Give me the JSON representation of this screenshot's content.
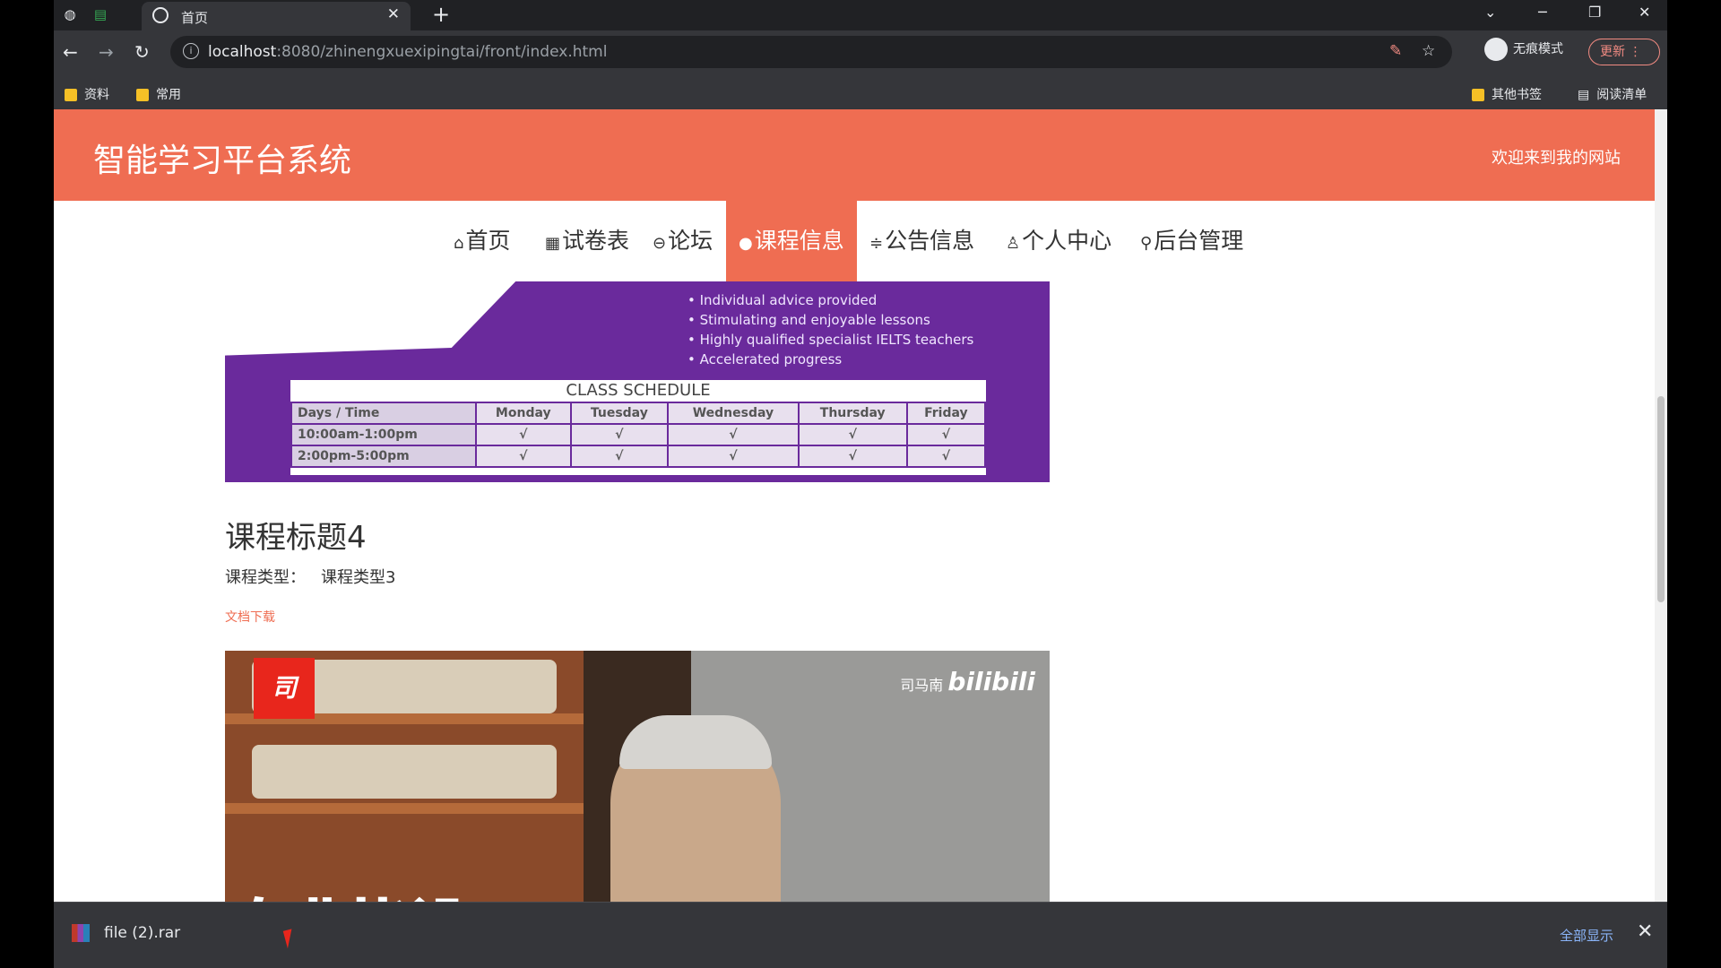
{
  "browser": {
    "tab_title": "首页",
    "url_host": "localhost",
    "url_path": ":8080/zhinengxuexipingtai/front/index.html",
    "incognito_label": "无痕模式",
    "update_label": "更新",
    "bookmarks": [
      "资料",
      "常用"
    ],
    "other_bookmarks": "其他书签",
    "reading_list": "阅读清单"
  },
  "site": {
    "title": "智能学习平台系统",
    "welcome": "欢迎来到我的网站"
  },
  "nav": {
    "items": [
      {
        "icon": "⌂",
        "label": "首页"
      },
      {
        "icon": "▦",
        "label": "试卷表"
      },
      {
        "icon": "⊖",
        "label": "论坛"
      },
      {
        "icon": "●",
        "label": "课程信息"
      },
      {
        "icon": "≑",
        "label": "公告信息"
      },
      {
        "icon": "♙",
        "label": "个人中心"
      },
      {
        "icon": "⚲",
        "label": "后台管理"
      }
    ],
    "active_index": 3
  },
  "banner": {
    "bullets": [
      "• Individual advice provided",
      "• Stimulating and enjoyable lessons",
      "• Highly qualified specialist IELTS teachers",
      "• Accelerated progress"
    ],
    "schedule_title": "CLASS SCHEDULE",
    "columns": [
      "Days / Time",
      "Monday",
      "Tuesday",
      "Wednesday",
      "Thursday",
      "Friday"
    ],
    "rows": [
      [
        "10:00am-1:00pm",
        "√",
        "√",
        "√",
        "√",
        "√"
      ],
      [
        "2:00pm-5:00pm",
        "√",
        "√",
        "√",
        "√",
        "√"
      ]
    ]
  },
  "course": {
    "title": "课程标题4",
    "type_label": "课程类型：",
    "type_value": "课程类型3",
    "download_label": "文档下载"
  },
  "video": {
    "badge": "司",
    "brand_name": "司马南",
    "brand_logo": "bilibili",
    "subtitle": "专业毕设"
  },
  "download_bar": {
    "file_name": "file (2).rar",
    "show_all": "全部显示"
  }
}
